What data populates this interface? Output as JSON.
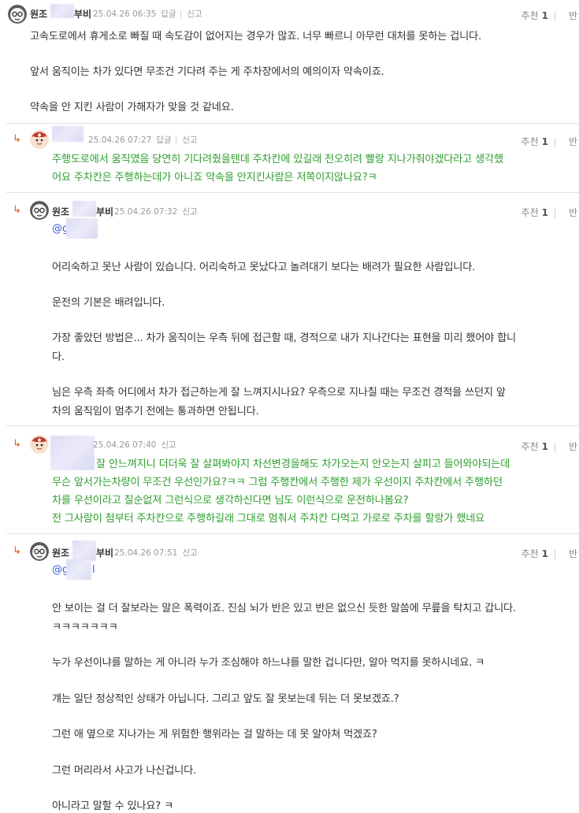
{
  "colors": {
    "green_text": "#2f9e2f",
    "mention": "#3b5cd6",
    "reply_arrow": "#e05a1a",
    "meta": "#999999"
  },
  "comments": [
    {
      "author_prefix": "원조",
      "author_suffix": "부비",
      "date": "25.04.26 06:35",
      "reply_label": "답글",
      "report_label": "신고",
      "recommend_label": "추천",
      "recommend_count": "1",
      "oppose_label": "반",
      "lines": [
        "고속도로에서 휴게소로 빠질 때 속도감이 없어지는 경우가 많죠. 너무 빠르니 아무런 대처를 못하는 겁니다.",
        "앞서 움직이는 차가 있다면 무조건 기다려 주는 게 주차장에서의 예의이자 약속이죠.",
        "약속을 안 지킨 사람이 가해자가 맞을 것 같네요."
      ]
    },
    {
      "reply_arrow": "↳",
      "date": "25.04.26 07:27",
      "reply_label": "답글",
      "report_label": "신고",
      "recommend_label": "추천",
      "recommend_count": "1",
      "oppose_label": "반",
      "lines": [
        "주행도로에서 움직였음 당연히 기다려줬을텐데 주차칸에 있길래 전오히려 빨랑 지나가줘야겠다라고 생각했",
        "어요 주차칸은 주행하는데가 아니죠 약속을 안지킨사람은 저쪽이지않나요?ㅋ"
      ]
    },
    {
      "reply_arrow": "↳",
      "author_prefix": "원조",
      "author_suffix": "부비",
      "date": "25.04.26 07:32",
      "report_label": "신고",
      "recommend_label": "추천",
      "recommend_count": "1",
      "oppose_label": "반",
      "mention": "@g",
      "lines": [
        "어리숙하고 못난 사람이 있습니다. 어리숙하고 못났다고 놀려대기 보다는 배려가 필요한 사람입니다.",
        "운전의 기본은 배려입니다.",
        "가장 좋았던 방법은... 차가 움직이는 우측 뒤에 접근할 때, 경적으로 내가 지나간다는 표현을 미리 했어야 합니",
        "다.",
        "님은 우측 좌측 어디에서 차가 접근하는게 잘 느껴지시나요? 우측으로 지나칠 때는 무조건 경적을 쓰던지 앞",
        "차의 움직임이 멈추기 전에는 통과하면 안됩니다."
      ]
    },
    {
      "reply_arrow": "↳",
      "date": "25.04.26 07:40",
      "report_label": "신고",
      "recommend_label": "추천",
      "recommend_count": "1",
      "oppose_label": "반",
      "lines": [
        "잘 안느껴지니 더더욱 잘 살펴봐야지 차선변경을해도 차가오는지 안오는지 살피고 들어와야되는데",
        "무슨 앞서가는차량이 무조건 우선인가요?ㅋㅋ 그럼 주행칸에서 주행한 제가 우선이지 주차칸에서 주행하던",
        "차를 우선이라고 칠순없져 그런식으로 생각하신다면 님도 이런식으로 운전하나봄요?",
        "전 그사람이 첨부터 주차칸으로 주행하길래 그대로 멈춰서 주차칸 다먹고 가로로 주차를 할랑가 했네요"
      ]
    },
    {
      "reply_arrow": "↳",
      "author_prefix": "원조",
      "author_suffix": "부비",
      "date": "25.04.26 07:51",
      "report_label": "신고",
      "recommend_label": "추천",
      "recommend_count": "1",
      "oppose_label": "반",
      "mention": "@g",
      "mention_tail": "l",
      "lines": [
        "안 보이는 걸 더 잘보라는 말은 폭력이죠. 진심 뇌가 반은 있고 반은 없으신 듯한 말씀에 무릎을 탁치고 갑니다.",
        "ㅋㅋㅋㅋㅋㅋㅋ",
        "누가 우선이냐를 말하는 게 아니라 누가 조심해야 하느냐를 말한 겁니다만, 알아 먹지를 못하시네요. ㅋ",
        "걔는 일단 정상적인 상태가 아닙니다. 그리고 앞도 잘 못보는데 뒤는 더 못보겠죠.?",
        "그런 애 옆으로 지나가는 게 위험한 행위라는 걸 말하는 데 못 알아쳐 먹겠죠?",
        "그런 머리라서 사고가 나신겁니다.",
        "아니라고 말할 수 있나요? ㅋ"
      ]
    }
  ]
}
